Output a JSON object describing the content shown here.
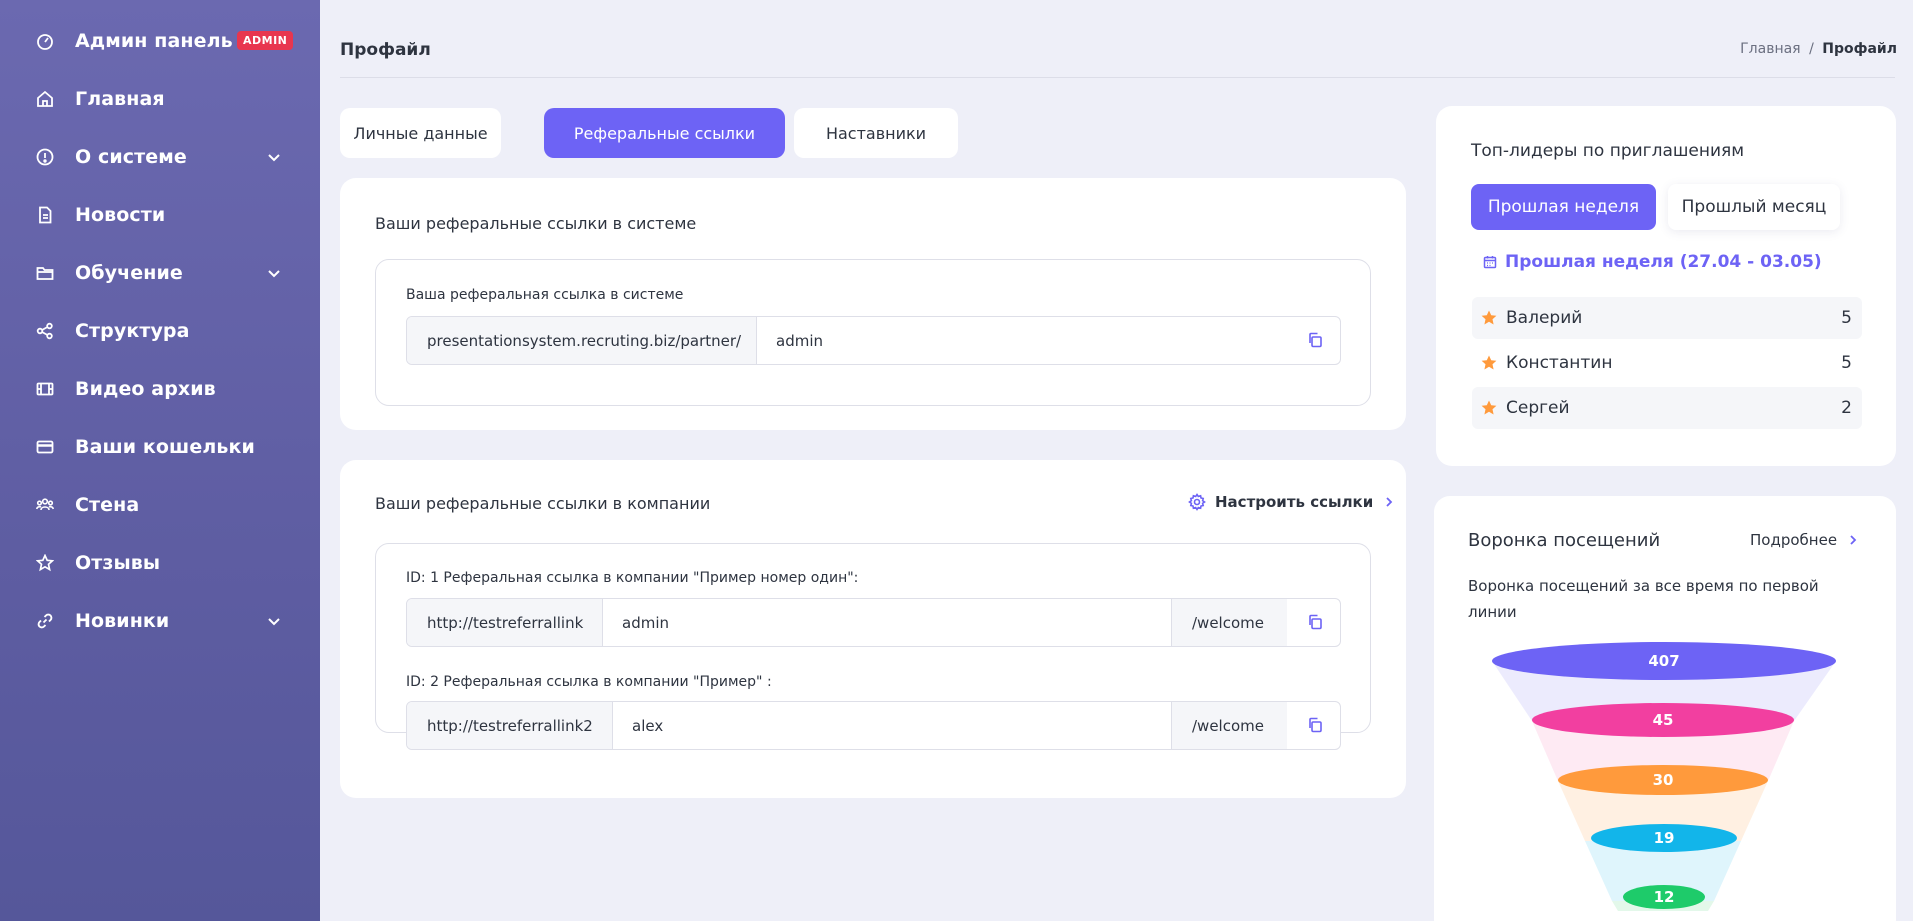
{
  "sidebar": {
    "admin_badge": "ADMIN",
    "items": [
      {
        "label": "Админ панель",
        "icon": "dashboard-icon"
      },
      {
        "label": "Главная",
        "icon": "home-icon"
      },
      {
        "label": "О системе",
        "icon": "info-icon"
      },
      {
        "label": "Новости",
        "icon": "document-icon"
      },
      {
        "label": "Обучение",
        "icon": "folder-icon"
      },
      {
        "label": "Структура",
        "icon": "share-icon"
      },
      {
        "label": "Видео архив",
        "icon": "film-icon"
      },
      {
        "label": "Ваши кошельки",
        "icon": "credit-card-icon"
      },
      {
        "label": "Стена",
        "icon": "users-icon"
      },
      {
        "label": "Отзывы",
        "icon": "star-icon"
      },
      {
        "label": "Новинки",
        "icon": "link-icon"
      }
    ]
  },
  "header": {
    "title": "Профайл",
    "breadcrumb": {
      "home": "Главная",
      "separator": "/",
      "current": "Профайл"
    }
  },
  "tabs": [
    {
      "label": "Личные данные",
      "active": false
    },
    {
      "label": "Реферальные ссылки",
      "active": true
    },
    {
      "label": "Наставники",
      "active": false
    }
  ],
  "system_links": {
    "title": "Ваши реферальные ссылки в системе",
    "field_label": "Ваша реферальная ссылка в системе",
    "prefix": "presentationsystem.recruting.biz/partner/",
    "value": "admin"
  },
  "company_links": {
    "title": "Ваши реферальные ссылки в компании",
    "configure_label": "Настроить ссылки",
    "links": [
      {
        "label": "ID: 1 Реферальная ссылка в компании \"Пример номер один\":",
        "prefix": "http://testreferrallink",
        "value": "admin",
        "suffix": "/welcome"
      },
      {
        "label": "ID: 2 Реферальная ссылка в компании \"Пример\" :",
        "prefix": "http://testreferrallink2",
        "value": "alex",
        "suffix": "/welcome"
      }
    ]
  },
  "leaders": {
    "title": "Топ-лидеры по приглашениям",
    "period_buttons": [
      "Прошлая неделя",
      "Прошлый месяц"
    ],
    "period_label": "Прошлая неделя (27.04 - 03.05)",
    "list": [
      {
        "name": "Валерий",
        "count": "5"
      },
      {
        "name": "Константин",
        "count": "5"
      },
      {
        "name": "Сергей",
        "count": "2"
      }
    ]
  },
  "funnel": {
    "title": "Воронка посещений",
    "more_label": "Подробнее",
    "subtitle": "Воронка посещений за все время по первой линии",
    "levels": [
      {
        "value": "407",
        "color": "#6d63f5"
      },
      {
        "value": "45",
        "color": "#f23fa0"
      },
      {
        "value": "30",
        "color": "#ff9a3c"
      },
      {
        "value": "19",
        "color": "#12b5ea"
      },
      {
        "value": "12",
        "color": "#1ecb6a"
      }
    ]
  }
}
